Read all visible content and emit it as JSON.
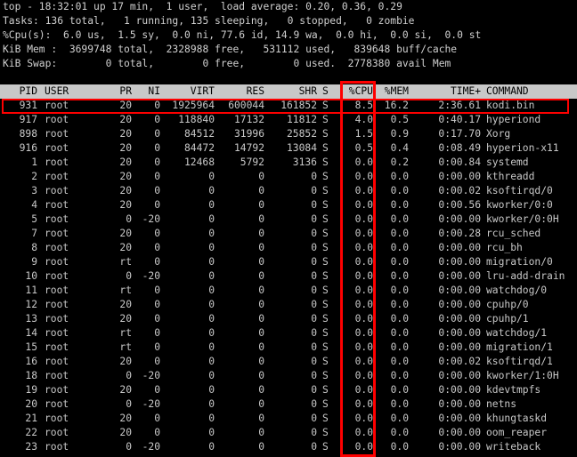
{
  "summary": {
    "line1": "top - 18:32:01 up 17 min,  1 user,  load average: 0.20, 0.36, 0.29",
    "line2": "Tasks: 136 total,   1 running, 135 sleeping,   0 stopped,   0 zombie",
    "line3": "%Cpu(s):  6.0 us,  1.5 sy,  0.0 ni, 77.6 id, 14.9 wa,  0.0 hi,  0.0 si,  0.0 st",
    "line4": "KiB Mem :  3699748 total,  2328988 free,   531112 used,   839648 buff/cache",
    "line5": "KiB Swap:        0 total,        0 free,        0 used.  2778380 avail Mem"
  },
  "columns": {
    "pid": "PID",
    "user": "USER",
    "pr": "PR",
    "ni": "NI",
    "virt": "VIRT",
    "res": "RES",
    "shr": "SHR",
    "s": "S",
    "cpu": "%CPU",
    "mem": "%MEM",
    "time": "TIME+",
    "command": "COMMAND"
  },
  "processes": [
    {
      "pid": "931",
      "user": "root",
      "pr": "20",
      "ni": "0",
      "virt": "1925964",
      "res": "600044",
      "shr": "161852",
      "s": "S",
      "cpu": "8.5",
      "mem": "16.2",
      "time": "2:36.61",
      "command": "kodi.bin"
    },
    {
      "pid": "917",
      "user": "root",
      "pr": "20",
      "ni": "0",
      "virt": "118840",
      "res": "17132",
      "shr": "11812",
      "s": "S",
      "cpu": "4.0",
      "mem": "0.5",
      "time": "0:40.17",
      "command": "hyperiond"
    },
    {
      "pid": "898",
      "user": "root",
      "pr": "20",
      "ni": "0",
      "virt": "84512",
      "res": "31996",
      "shr": "25852",
      "s": "S",
      "cpu": "1.5",
      "mem": "0.9",
      "time": "0:17.70",
      "command": "Xorg"
    },
    {
      "pid": "916",
      "user": "root",
      "pr": "20",
      "ni": "0",
      "virt": "84472",
      "res": "14792",
      "shr": "13084",
      "s": "S",
      "cpu": "0.5",
      "mem": "0.4",
      "time": "0:08.49",
      "command": "hyperion-x11"
    },
    {
      "pid": "1",
      "user": "root",
      "pr": "20",
      "ni": "0",
      "virt": "12468",
      "res": "5792",
      "shr": "3136",
      "s": "S",
      "cpu": "0.0",
      "mem": "0.2",
      "time": "0:00.84",
      "command": "systemd"
    },
    {
      "pid": "2",
      "user": "root",
      "pr": "20",
      "ni": "0",
      "virt": "0",
      "res": "0",
      "shr": "0",
      "s": "S",
      "cpu": "0.0",
      "mem": "0.0",
      "time": "0:00.00",
      "command": "kthreadd"
    },
    {
      "pid": "3",
      "user": "root",
      "pr": "20",
      "ni": "0",
      "virt": "0",
      "res": "0",
      "shr": "0",
      "s": "S",
      "cpu": "0.0",
      "mem": "0.0",
      "time": "0:00.02",
      "command": "ksoftirqd/0"
    },
    {
      "pid": "4",
      "user": "root",
      "pr": "20",
      "ni": "0",
      "virt": "0",
      "res": "0",
      "shr": "0",
      "s": "S",
      "cpu": "0.0",
      "mem": "0.0",
      "time": "0:00.56",
      "command": "kworker/0:0"
    },
    {
      "pid": "5",
      "user": "root",
      "pr": "0",
      "ni": "-20",
      "virt": "0",
      "res": "0",
      "shr": "0",
      "s": "S",
      "cpu": "0.0",
      "mem": "0.0",
      "time": "0:00.00",
      "command": "kworker/0:0H"
    },
    {
      "pid": "7",
      "user": "root",
      "pr": "20",
      "ni": "0",
      "virt": "0",
      "res": "0",
      "shr": "0",
      "s": "S",
      "cpu": "0.0",
      "mem": "0.0",
      "time": "0:00.28",
      "command": "rcu_sched"
    },
    {
      "pid": "8",
      "user": "root",
      "pr": "20",
      "ni": "0",
      "virt": "0",
      "res": "0",
      "shr": "0",
      "s": "S",
      "cpu": "0.0",
      "mem": "0.0",
      "time": "0:00.00",
      "command": "rcu_bh"
    },
    {
      "pid": "9",
      "user": "root",
      "pr": "rt",
      "ni": "0",
      "virt": "0",
      "res": "0",
      "shr": "0",
      "s": "S",
      "cpu": "0.0",
      "mem": "0.0",
      "time": "0:00.00",
      "command": "migration/0"
    },
    {
      "pid": "10",
      "user": "root",
      "pr": "0",
      "ni": "-20",
      "virt": "0",
      "res": "0",
      "shr": "0",
      "s": "S",
      "cpu": "0.0",
      "mem": "0.0",
      "time": "0:00.00",
      "command": "lru-add-drain"
    },
    {
      "pid": "11",
      "user": "root",
      "pr": "rt",
      "ni": "0",
      "virt": "0",
      "res": "0",
      "shr": "0",
      "s": "S",
      "cpu": "0.0",
      "mem": "0.0",
      "time": "0:00.00",
      "command": "watchdog/0"
    },
    {
      "pid": "12",
      "user": "root",
      "pr": "20",
      "ni": "0",
      "virt": "0",
      "res": "0",
      "shr": "0",
      "s": "S",
      "cpu": "0.0",
      "mem": "0.0",
      "time": "0:00.00",
      "command": "cpuhp/0"
    },
    {
      "pid": "13",
      "user": "root",
      "pr": "20",
      "ni": "0",
      "virt": "0",
      "res": "0",
      "shr": "0",
      "s": "S",
      "cpu": "0.0",
      "mem": "0.0",
      "time": "0:00.00",
      "command": "cpuhp/1"
    },
    {
      "pid": "14",
      "user": "root",
      "pr": "rt",
      "ni": "0",
      "virt": "0",
      "res": "0",
      "shr": "0",
      "s": "S",
      "cpu": "0.0",
      "mem": "0.0",
      "time": "0:00.00",
      "command": "watchdog/1"
    },
    {
      "pid": "15",
      "user": "root",
      "pr": "rt",
      "ni": "0",
      "virt": "0",
      "res": "0",
      "shr": "0",
      "s": "S",
      "cpu": "0.0",
      "mem": "0.0",
      "time": "0:00.00",
      "command": "migration/1"
    },
    {
      "pid": "16",
      "user": "root",
      "pr": "20",
      "ni": "0",
      "virt": "0",
      "res": "0",
      "shr": "0",
      "s": "S",
      "cpu": "0.0",
      "mem": "0.0",
      "time": "0:00.02",
      "command": "ksoftirqd/1"
    },
    {
      "pid": "18",
      "user": "root",
      "pr": "0",
      "ni": "-20",
      "virt": "0",
      "res": "0",
      "shr": "0",
      "s": "S",
      "cpu": "0.0",
      "mem": "0.0",
      "time": "0:00.00",
      "command": "kworker/1:0H"
    },
    {
      "pid": "19",
      "user": "root",
      "pr": "20",
      "ni": "0",
      "virt": "0",
      "res": "0",
      "shr": "0",
      "s": "S",
      "cpu": "0.0",
      "mem": "0.0",
      "time": "0:00.00",
      "command": "kdevtmpfs"
    },
    {
      "pid": "20",
      "user": "root",
      "pr": "0",
      "ni": "-20",
      "virt": "0",
      "res": "0",
      "shr": "0",
      "s": "S",
      "cpu": "0.0",
      "mem": "0.0",
      "time": "0:00.00",
      "command": "netns"
    },
    {
      "pid": "21",
      "user": "root",
      "pr": "20",
      "ni": "0",
      "virt": "0",
      "res": "0",
      "shr": "0",
      "s": "S",
      "cpu": "0.0",
      "mem": "0.0",
      "time": "0:00.00",
      "command": "khungtaskd"
    },
    {
      "pid": "22",
      "user": "root",
      "pr": "20",
      "ni": "0",
      "virt": "0",
      "res": "0",
      "shr": "0",
      "s": "S",
      "cpu": "0.0",
      "mem": "0.0",
      "time": "0:00.00",
      "command": "oom_reaper"
    },
    {
      "pid": "23",
      "user": "root",
      "pr": "0",
      "ni": "-20",
      "virt": "0",
      "res": "0",
      "shr": "0",
      "s": "S",
      "cpu": "0.0",
      "mem": "0.0",
      "time": "0:00.00",
      "command": "writeback"
    }
  ],
  "colors": {
    "background": "#000000",
    "text": "#c0c0c0",
    "header_bar": "#c8c8c8",
    "annotation": "#ff0000"
  }
}
